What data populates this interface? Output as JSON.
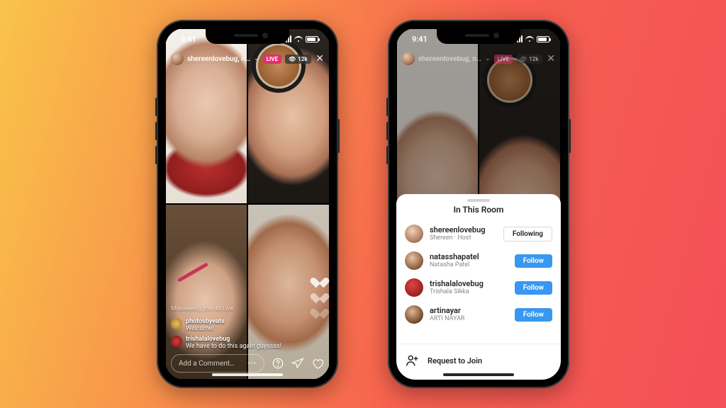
{
  "status": {
    "time": "9:41"
  },
  "header": {
    "username": "shereenlovebug, n…",
    "live_label": "LIVE",
    "viewer_count": "12k"
  },
  "comments": {
    "joined_text": "Missseeing you do Live",
    "items": [
      {
        "user": "photosbyeats",
        "text": "Welcome!"
      },
      {
        "user": "trishalalovebug",
        "text": "We have to do this again guyssss!"
      }
    ]
  },
  "footer": {
    "comment_placeholder": "Add a Comment…"
  },
  "sheet": {
    "title": "In This Room",
    "participants": [
      {
        "username": "shereenlovebug",
        "subtitle": "Shereen · Host",
        "button": "Following",
        "button_type": "following"
      },
      {
        "username": "natasshapatel",
        "subtitle": "Natasha Patel",
        "button": "Follow",
        "button_type": "follow"
      },
      {
        "username": "trishalalovebug",
        "subtitle": "Trishala Sikka",
        "button": "Follow",
        "button_type": "follow"
      },
      {
        "username": "artinayar",
        "subtitle": "ARTI NAYAR",
        "button": "Follow",
        "button_type": "follow"
      }
    ],
    "request_label": "Request to Join"
  }
}
